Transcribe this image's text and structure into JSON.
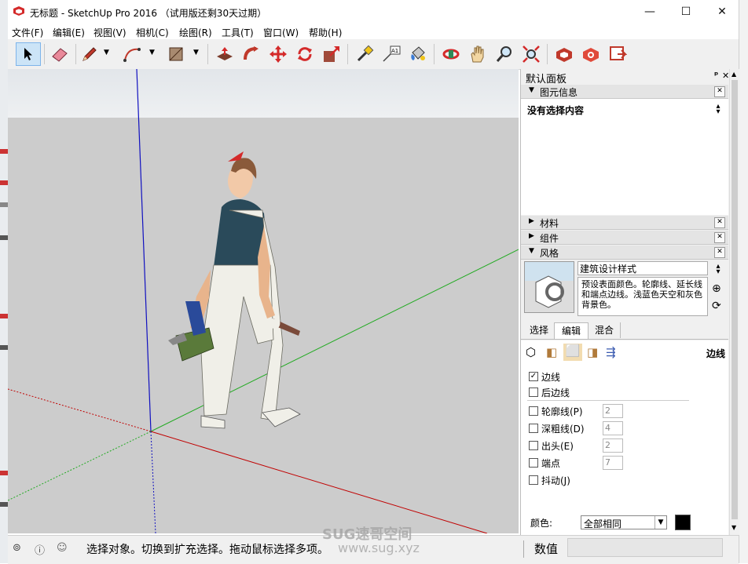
{
  "window": {
    "title": "无标题 - SketchUp Pro 2016 （试用版还剩30天过期）",
    "min_glyph": "—",
    "max_glyph": "☐",
    "close_glyph": "✕"
  },
  "menu": [
    "文件(F)",
    "编辑(E)",
    "视图(V)",
    "相机(C)",
    "绘图(R)",
    "工具(T)",
    "窗口(W)",
    "帮助(H)"
  ],
  "toolbar": {
    "tools": [
      "select-icon",
      "eraser-icon",
      "pencil-icon",
      "arc-icon",
      "rectangle-icon",
      "push-pull-icon",
      "follow-me-icon",
      "move-icon",
      "rotate-icon",
      "scale-icon",
      "tape-measure-icon",
      "text-icon",
      "paint-bucket-icon",
      "orbit-icon",
      "pan-icon",
      "zoom-icon",
      "zoom-extents-icon",
      "warehouse-icon",
      "extension-warehouse-icon",
      "layout-icon"
    ],
    "text_tool_label": "A1"
  },
  "panel": {
    "title": "默认面板",
    "pin_glyph": "ᵖ",
    "close_glyph": "✕",
    "entity_info": {
      "header": "图元信息",
      "no_selection": "没有选择内容"
    },
    "materials_header": "材料",
    "components_header": "组件",
    "styles": {
      "header": "风格",
      "style_name": "建筑设计样式",
      "description": "预设表面颜色。轮廓线、延长线和端点边线。浅蓝色天空和灰色背景色。",
      "tabs": [
        "选择",
        "编辑",
        "混合"
      ],
      "active_tab": "编辑",
      "section_label": "边线",
      "edge_options": [
        {
          "label": "边线",
          "checked": true
        },
        {
          "label": "后边线",
          "checked": false
        }
      ],
      "numeric_options": [
        {
          "label": "轮廓线(P)",
          "value": "2",
          "checked": false
        },
        {
          "label": "深粗线(D)",
          "value": "4",
          "checked": false
        },
        {
          "label": "出头(E)",
          "value": "2",
          "checked": false
        },
        {
          "label": "端点",
          "value": "7",
          "checked": false
        },
        {
          "label": "抖动(J)",
          "value": "",
          "checked": false
        }
      ],
      "color_label": "颜色:",
      "color_select": "全部相同",
      "color_swatch": "#000000"
    }
  },
  "status": {
    "message": "选择对象。切换到扩充选择。拖动鼠标选择多项。",
    "measurement_label": "数值",
    "measurement_value": ""
  },
  "watermark": {
    "line1": "SUG速哥空间",
    "line2": "www.sug.xyz"
  },
  "colors": {
    "axis_red": "#c00000",
    "axis_green": "#22aa22",
    "axis_blue": "#1010c0",
    "sky": "#e8ebee",
    "ground": "#cccccc"
  }
}
